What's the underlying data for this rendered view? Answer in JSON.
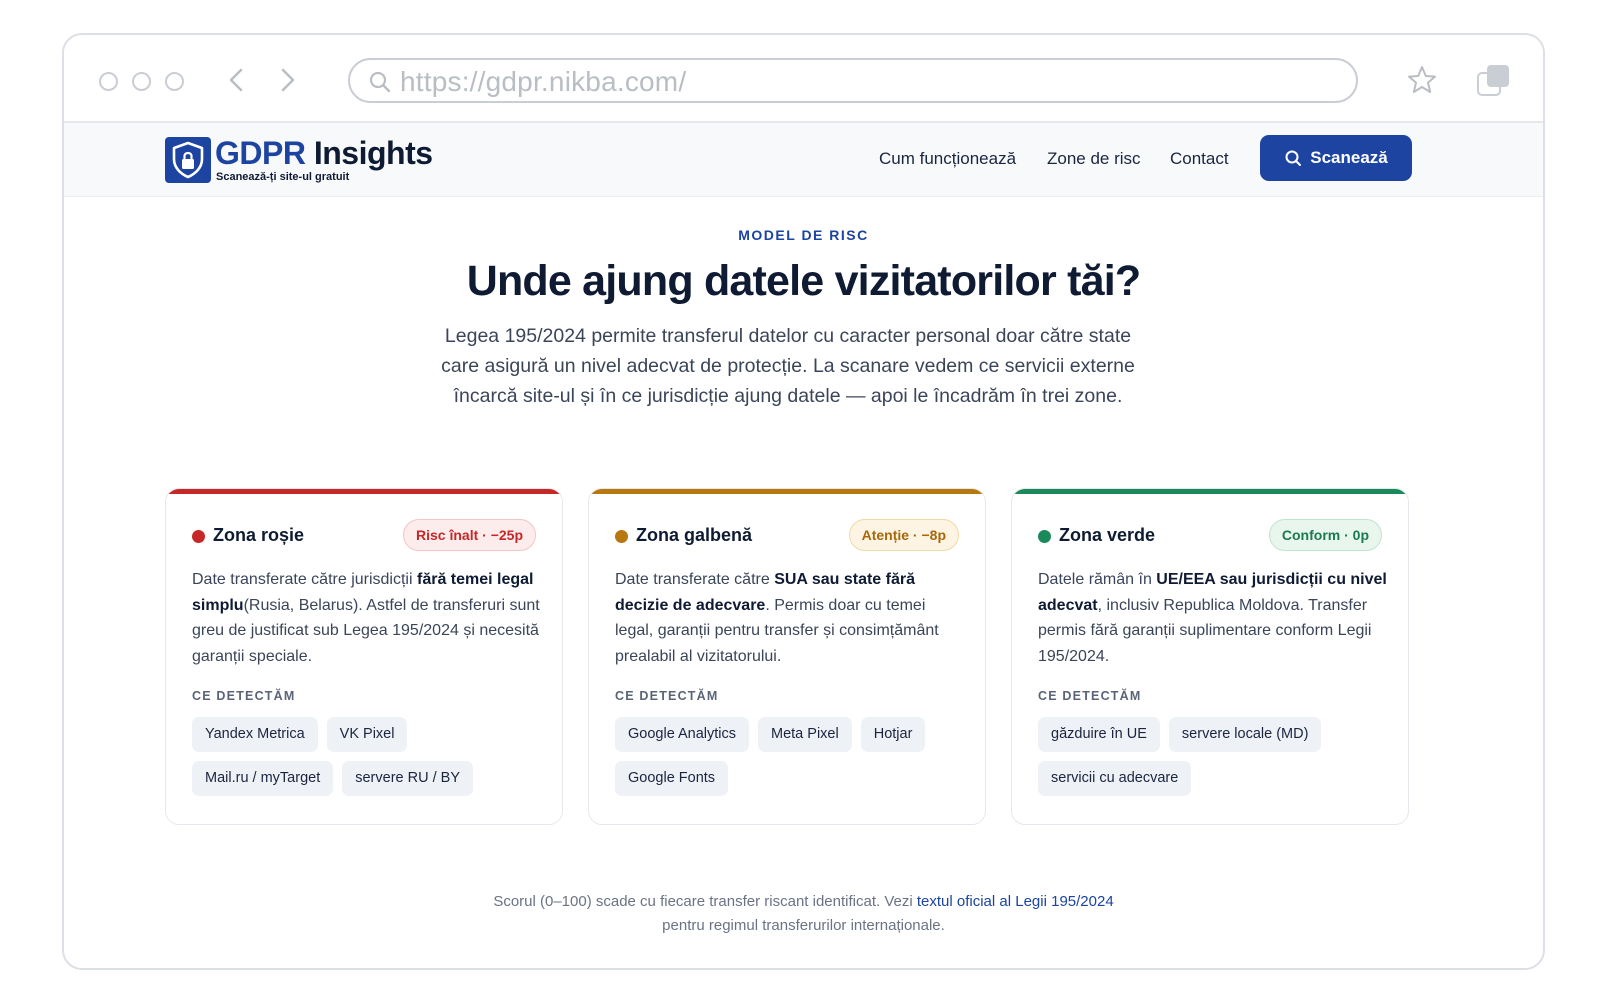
{
  "browser": {
    "url": "https://gdpr.nikba.com/"
  },
  "header": {
    "logo_gdpr": "GDPR",
    "logo_insights": "Insights",
    "logo_tagline": "Scanează-ți site-ul gratuit",
    "nav": [
      "Cum funcționează",
      "Zone de risc",
      "Contact"
    ],
    "scan_button": "Scanează"
  },
  "hero": {
    "eyebrow": "MODEL DE RISC",
    "title": "Unde ajung datele vizitatorilor tăi?",
    "lead": "Legea 195/2024 permite transferul datelor cu caracter personal doar către state care asigură un nivel adecvat de protecție. La scanare vedem ce servicii externe încarcă site-ul și în ce jurisdicție ajung datele — apoi le încadrăm în trei zone."
  },
  "cards": [
    {
      "title": "Zona roșie",
      "badge": "Risc înalt · −25p",
      "accent": "#c62828",
      "badge_bg": "#fdecec",
      "badge_border": "#f5c4c4",
      "badge_color": "#c62828",
      "desc_pre": "Date transferate către jurisdicții ",
      "desc_bold": "fără temei legal simplu",
      "desc_post": "(Rusia, Belarus). Astfel de transferuri sunt greu de justificat sub Legea 195/2024 și necesită garanții speciale.",
      "detect_label": "CE DETECTĂM",
      "chips": [
        "Yandex Metrica",
        "VK Pixel",
        "Mail.ru / myTarget",
        "servere RU / BY"
      ]
    },
    {
      "title": "Zona galbenă",
      "badge": "Atenție · −8p",
      "accent": "#b7790f",
      "badge_bg": "#fdf4e4",
      "badge_border": "#f1d9a8",
      "badge_color": "#a8680a",
      "desc_pre": "Date transferate către ",
      "desc_bold": "SUA sau state fără decizie de adecvare",
      "desc_post": ". Permis doar cu temei legal, garanții pentru transfer și consimțământ prealabil al vizitatorului.",
      "detect_label": "CE DETECTĂM",
      "chips": [
        "Google Analytics",
        "Meta Pixel",
        "Hotjar",
        "Google Fonts"
      ]
    },
    {
      "title": "Zona verde",
      "badge": "Conform · 0p",
      "accent": "#1b8a5a",
      "badge_bg": "#e8f6ee",
      "badge_border": "#bfe5cf",
      "badge_color": "#1b7a4f",
      "desc_pre": "Datele rămân în ",
      "desc_bold": "UE/EEA sau jurisdicții cu nivel adecvat",
      "desc_post": ", inclusiv Republica Moldova. Transfer permis fără garanții suplimentare conform Legii 195/2024.",
      "detect_label": "CE DETECTĂM",
      "chips": [
        "găzduire în UE",
        "servere locale (MD)",
        "servicii cu adecvare"
      ]
    }
  ],
  "footnote": {
    "pre": "Scorul (0–100) scade cu fiecare transfer riscant identificat. Vezi ",
    "link": "textul oficial al Legii 195/2024",
    "post": " pentru regimul transferurilor internaționale."
  },
  "icons": {
    "window_dots": [
      "circle-icon",
      "circle-icon",
      "circle-icon"
    ],
    "back": "chevron-left-icon",
    "forward": "chevron-right-icon",
    "search": "search-icon",
    "bookmark": "star-icon",
    "tabs": "tabs-icon",
    "logo": "shield-lock-icon"
  },
  "colors": {
    "brand": "#1c44a0"
  }
}
